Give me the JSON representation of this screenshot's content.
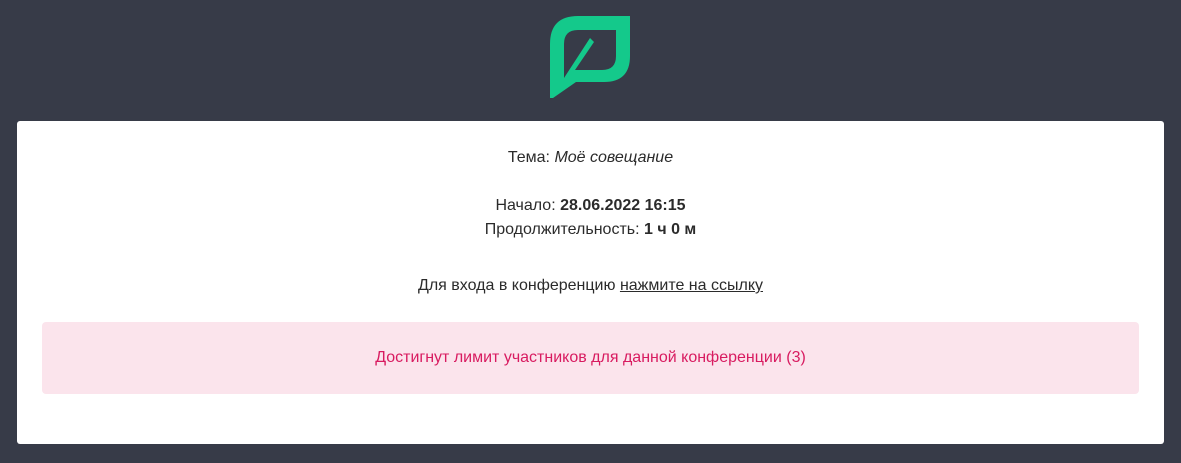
{
  "brand": {
    "logo": "leaf-logo-icon",
    "logo_color": "#14c98b"
  },
  "meeting": {
    "topic_label": "Тема: ",
    "topic_value": "Моё совещание",
    "start_label": "Начало: ",
    "start_value": "28.06.2022 16:15",
    "duration_label": "Продолжительность: ",
    "duration_value": "1 ч 0 м",
    "join_text": "Для входа в конференцию ",
    "join_link": "нажмите на ссылку"
  },
  "alert": {
    "message": "Достигнут лимит участников для данной конференции (3)",
    "color": "#d81b60",
    "background": "#fbe4ec"
  },
  "colors": {
    "page_background": "#373b48",
    "card_background": "#ffffff"
  }
}
